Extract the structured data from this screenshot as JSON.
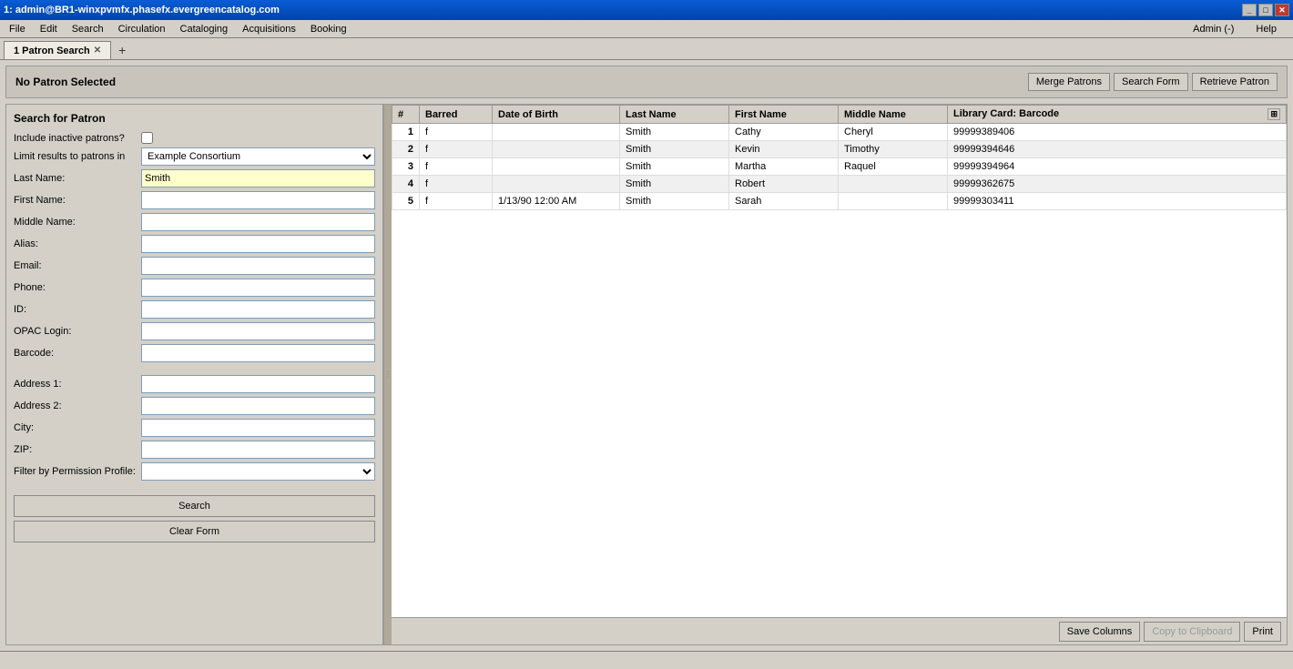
{
  "titlebar": {
    "title": "1: admin@BR1-winxpvmfx.phasefx.evergreencatalog.com",
    "minimize_label": "_",
    "maximize_label": "□",
    "close_label": "✕"
  },
  "menubar": {
    "items": [
      {
        "id": "file",
        "label": "File"
      },
      {
        "id": "edit",
        "label": "Edit"
      },
      {
        "id": "search",
        "label": "Search"
      },
      {
        "id": "circulation",
        "label": "Circulation"
      },
      {
        "id": "cataloging",
        "label": "Cataloging"
      },
      {
        "id": "acquisitions",
        "label": "Acquisitions"
      },
      {
        "id": "booking",
        "label": "Booking"
      }
    ],
    "admin_label": "Admin (-)",
    "help_label": "Help"
  },
  "tabs": [
    {
      "id": "patron-search",
      "label": "1 Patron Search",
      "active": true
    }
  ],
  "tab_add_label": "+",
  "patron_header": {
    "status": "No Patron Selected",
    "merge_btn": "Merge Patrons",
    "search_form_btn": "Search Form",
    "retrieve_btn": "Retrieve Patron"
  },
  "search_form": {
    "title": "Search for Patron",
    "inactive_label": "Include inactive patrons?",
    "limit_label": "Limit results to patrons in",
    "limit_value": "Example Consortium",
    "last_name_label": "Last Name:",
    "last_name_value": "Smith",
    "first_name_label": "First Name:",
    "first_name_value": "",
    "middle_name_label": "Middle Name:",
    "middle_name_value": "",
    "alias_label": "Alias:",
    "alias_value": "",
    "email_label": "Email:",
    "email_value": "",
    "phone_label": "Phone:",
    "phone_value": "",
    "id_label": "ID:",
    "id_value": "",
    "opac_login_label": "OPAC Login:",
    "opac_login_value": "",
    "barcode_label": "Barcode:",
    "barcode_value": "",
    "address1_label": "Address 1:",
    "address1_value": "",
    "address2_label": "Address 2:",
    "address2_value": "",
    "city_label": "City:",
    "city_value": "",
    "zip_label": "ZIP:",
    "zip_value": "",
    "filter_label": "Filter by Permission Profile:",
    "filter_value": "",
    "search_btn": "Search",
    "clear_btn": "Clear Form"
  },
  "results_table": {
    "columns": [
      {
        "id": "num",
        "label": "#"
      },
      {
        "id": "barred",
        "label": "Barred"
      },
      {
        "id": "dob",
        "label": "Date of Birth"
      },
      {
        "id": "last_name",
        "label": "Last Name"
      },
      {
        "id": "first_name",
        "label": "First Name"
      },
      {
        "id": "middle_name",
        "label": "Middle Name"
      },
      {
        "id": "library_card",
        "label": "Library Card: Barcode"
      }
    ],
    "rows": [
      {
        "num": "1",
        "barred": "f",
        "dob": "",
        "last_name": "Smith",
        "first_name": "Cathy",
        "middle_name": "Cheryl",
        "library_card": "99999389406"
      },
      {
        "num": "2",
        "barred": "f",
        "dob": "",
        "last_name": "Smith",
        "first_name": "Kevin",
        "middle_name": "Timothy",
        "library_card": "99999394646"
      },
      {
        "num": "3",
        "barred": "f",
        "dob": "",
        "last_name": "Smith",
        "first_name": "Martha",
        "middle_name": "Raquel",
        "library_card": "99999394964"
      },
      {
        "num": "4",
        "barred": "f",
        "dob": "",
        "last_name": "Smith",
        "first_name": "Robert",
        "middle_name": "",
        "library_card": "99999362675"
      },
      {
        "num": "5",
        "barred": "f",
        "dob": "1/13/90 12:00 AM",
        "last_name": "Smith",
        "first_name": "Sarah",
        "middle_name": "",
        "library_card": "99999303411"
      }
    ]
  },
  "bottom_bar": {
    "save_columns_btn": "Save Columns",
    "copy_clipboard_btn": "Copy to Clipboard",
    "print_btn": "Print"
  },
  "status_bar": {
    "text": ""
  }
}
